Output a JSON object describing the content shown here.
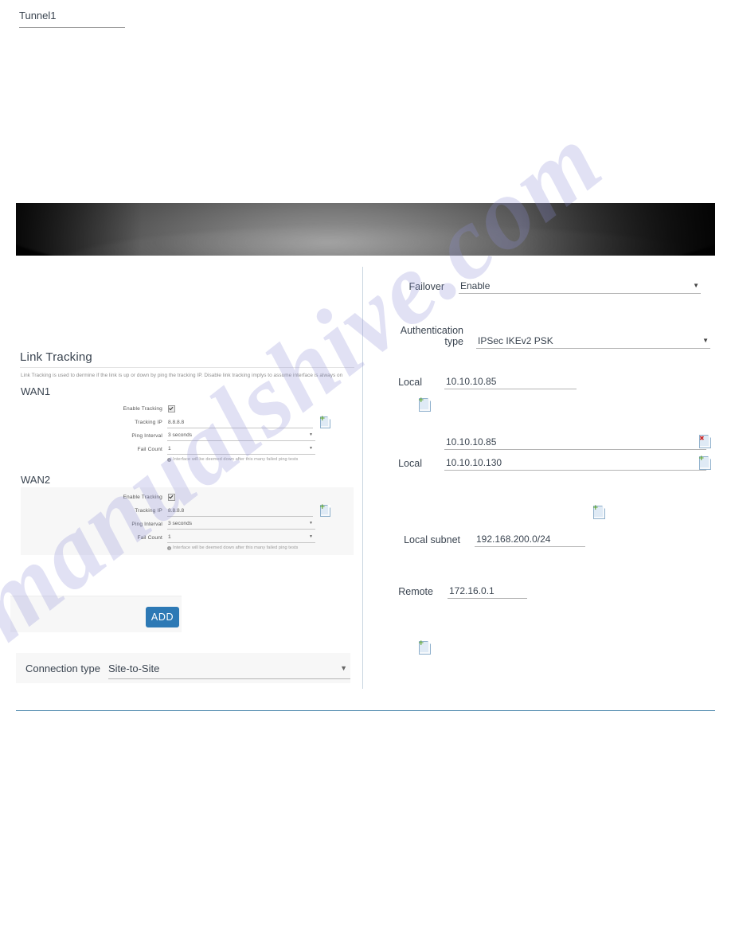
{
  "banner": {
    "alt": "dark-product-banner"
  },
  "watermark": {
    "text": "manualshive.com"
  },
  "link_tracking": {
    "title": "Link Tracking",
    "description": "Link Tracking is used to dermine if the link is up or down by ping the tracking IP. Disable link tracking implys to assume interface is always on",
    "hint": "Interface will be deemed down after this many failed ping tests",
    "labels": {
      "enable_tracking": "Enable Tracking",
      "tracking_ip": "Tracking IP",
      "ping_interval": "Ping Interval",
      "fail_count": "Fail Count"
    },
    "wan1": {
      "title": "WAN1",
      "enable_tracking": true,
      "tracking_ip": "8.8.8.8",
      "ping_interval": "3 seconds",
      "fail_count": "1"
    },
    "wan2": {
      "title": "WAN2",
      "enable_tracking": true,
      "tracking_ip": "8.8.8.8",
      "ping_interval": "3 seconds",
      "fail_count": "1"
    }
  },
  "tunnel": {
    "name_value": "Tunnel1",
    "add_label": "ADD"
  },
  "connection": {
    "label": "Connection type",
    "value": "Site-to-Site"
  },
  "vpn": {
    "failover": {
      "label": "Failover",
      "value": "Enable"
    },
    "auth_type": {
      "label": "Authentication type",
      "value": "IPSec IKEv2 PSK"
    },
    "local_single": {
      "label": "Local",
      "value": "10.10.10.85"
    },
    "local_multi": {
      "label": "Local",
      "values": [
        "10.10.10.85",
        "10.10.10.130"
      ]
    },
    "local_subnet": {
      "label": "Local subnet",
      "value": "192.168.200.0/24"
    },
    "remote": {
      "label": "Remote",
      "value": "172.16.0.1"
    }
  },
  "icons": {
    "add_row": "add-row-icon",
    "delete_row": "delete-row-icon",
    "dropdown": "▼"
  },
  "colors": {
    "accent_button": "#2d79b5",
    "footer_rule": "#3f7fa6",
    "panel_bg": "#f7f7f7",
    "add_icon_green": "#5aa32a",
    "delete_icon_red": "#cc2b2b"
  }
}
